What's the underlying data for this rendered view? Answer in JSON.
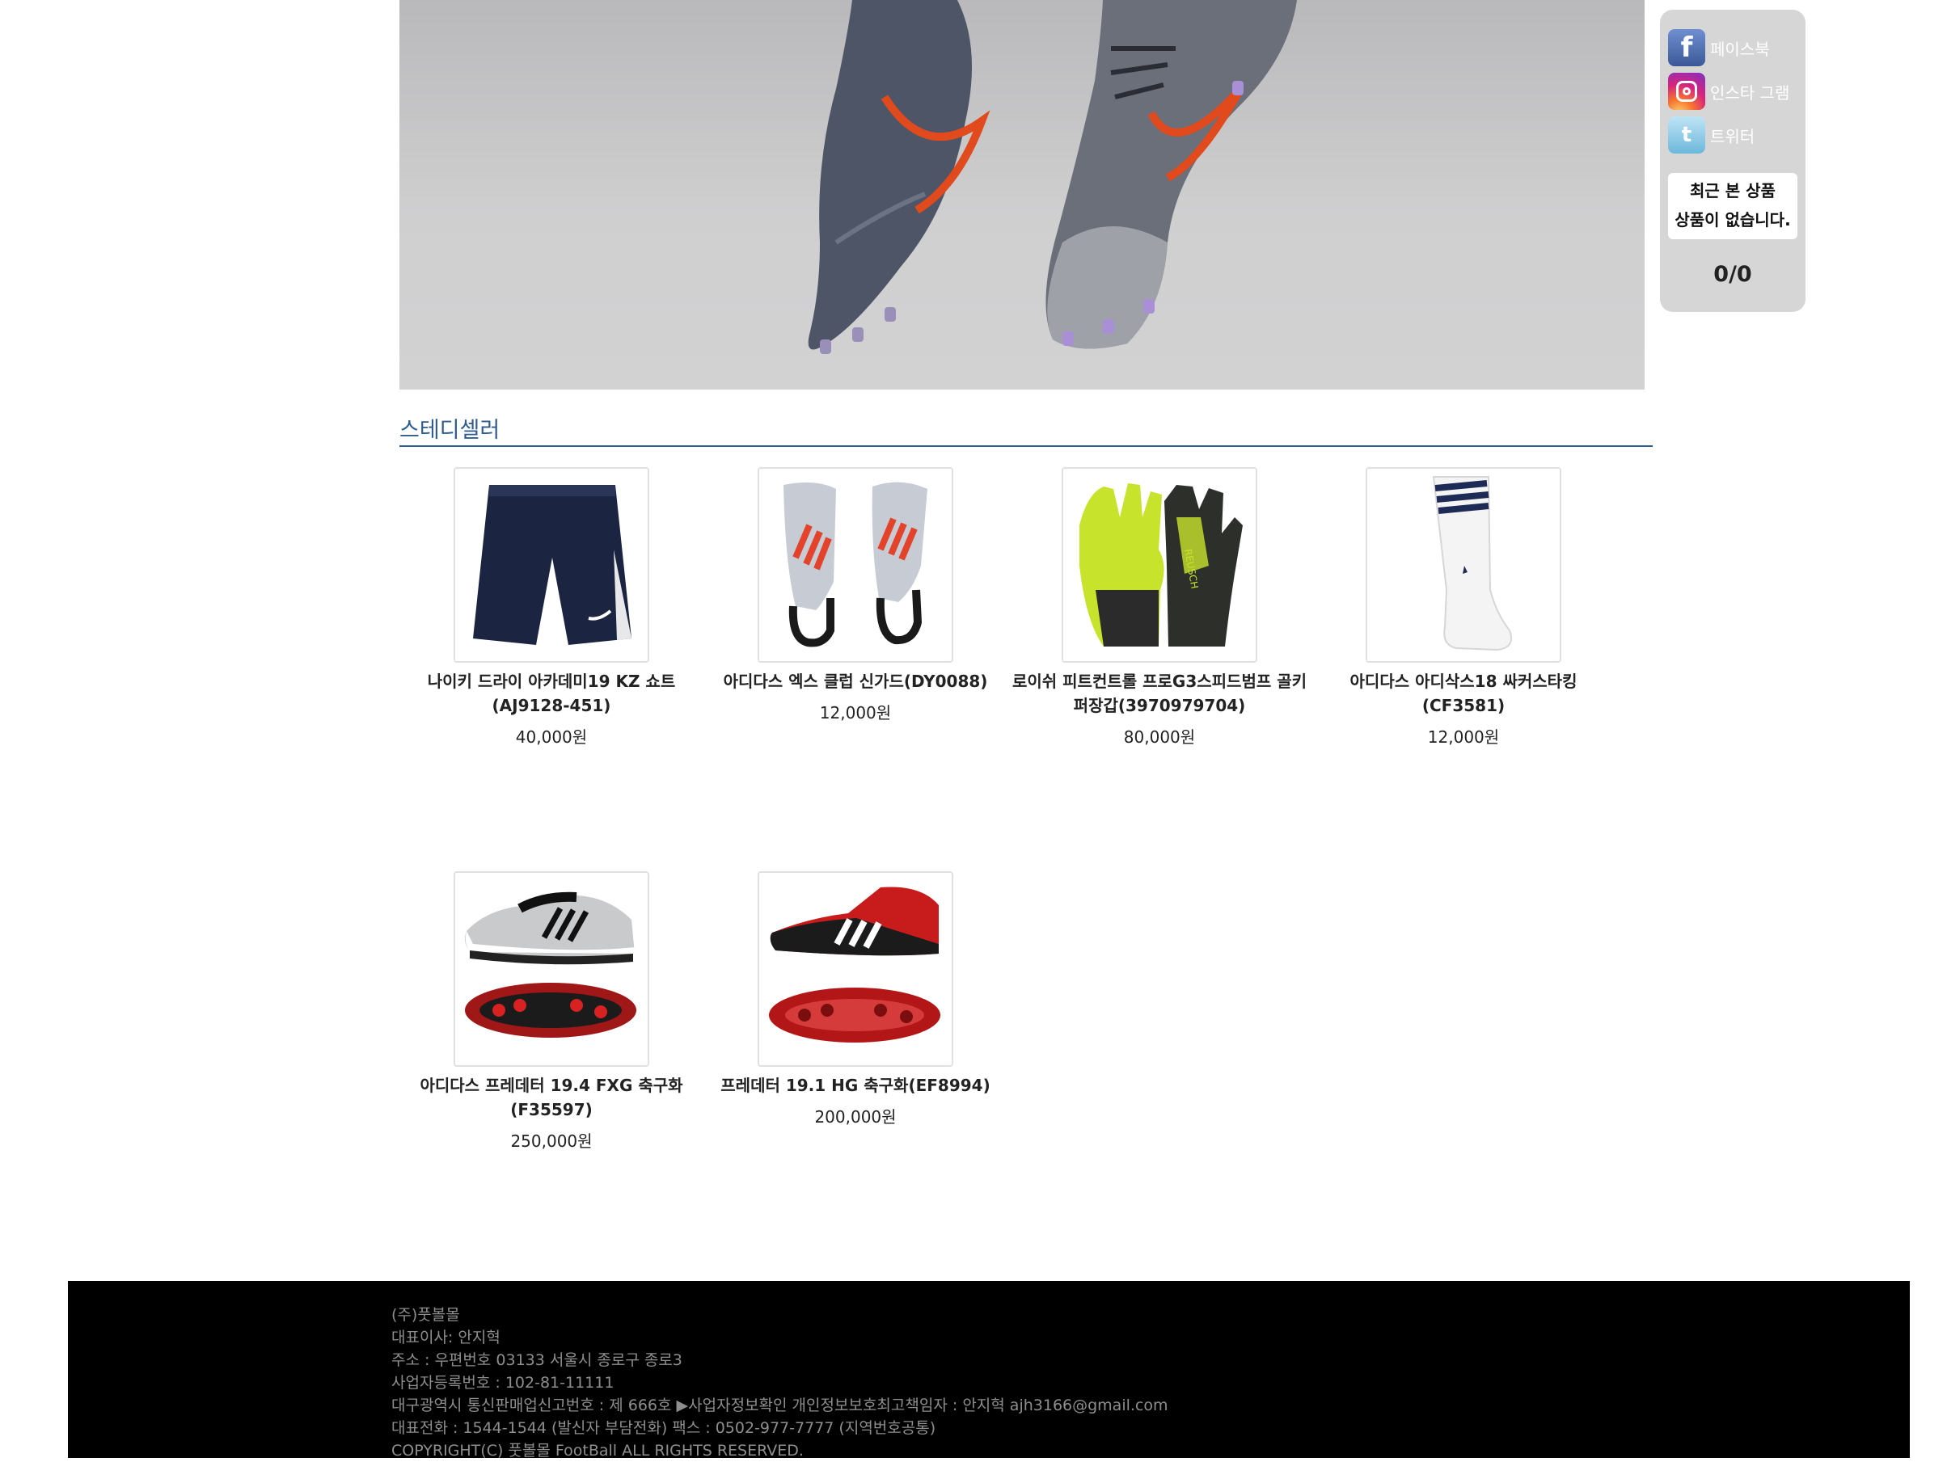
{
  "sidebar": {
    "sns": [
      {
        "label": "페이스북",
        "icon": "facebook-icon"
      },
      {
        "label": "인스타 그램",
        "icon": "instagram-icon"
      },
      {
        "label": "트위터",
        "icon": "twitter-icon"
      }
    ],
    "recent_title": "최근 본 상품",
    "recent_empty": "상품이 없습니다.",
    "pager": "0/0"
  },
  "section": {
    "title": "스테디셀러"
  },
  "products": [
    {
      "name": "나이키 드라이 아카데미19 KZ 쇼트 (AJ9128-451)",
      "price": "40,000원"
    },
    {
      "name": "아디다스 엑스 클럽 신가드(DY0088)",
      "price": "12,000원"
    },
    {
      "name": "로이쉬 피트컨트롤 프로G3스피드범프 골키퍼장갑(3970979704)",
      "price": "80,000원"
    },
    {
      "name": "아디다스 아디삭스18 싸커스타킹(CF3581)",
      "price": "12,000원"
    },
    {
      "name": "아디다스 프레데터 19.4 FXG 축구화 (F35597)",
      "price": "250,000원"
    },
    {
      "name": "프레데터 19.1 HG 축구화(EF8994)",
      "price": "200,000원"
    }
  ],
  "footer": {
    "company": "(주)풋볼몰",
    "ceo": "대표이사: 안지혁",
    "address": "주소 : 우편번호 03133 서울시 종로구 종로3",
    "biz_no": "사업자등록번호 : 102-81-11111",
    "mail_order": "대구광역시 통신판매업신고번호 : 제 666호 ▶사업자정보확인 개인정보보호최고책임자 : 안지혁 ajh3166@gmail.com",
    "phone": "대표전화 : 1544-1544 (발신자 부담전화) 팩스 : 0502-977-7777 (지역번호공통)",
    "copyright": "COPYRIGHT(C) 풋볼몰 FootBall ALL RIGHTS RESERVED."
  }
}
